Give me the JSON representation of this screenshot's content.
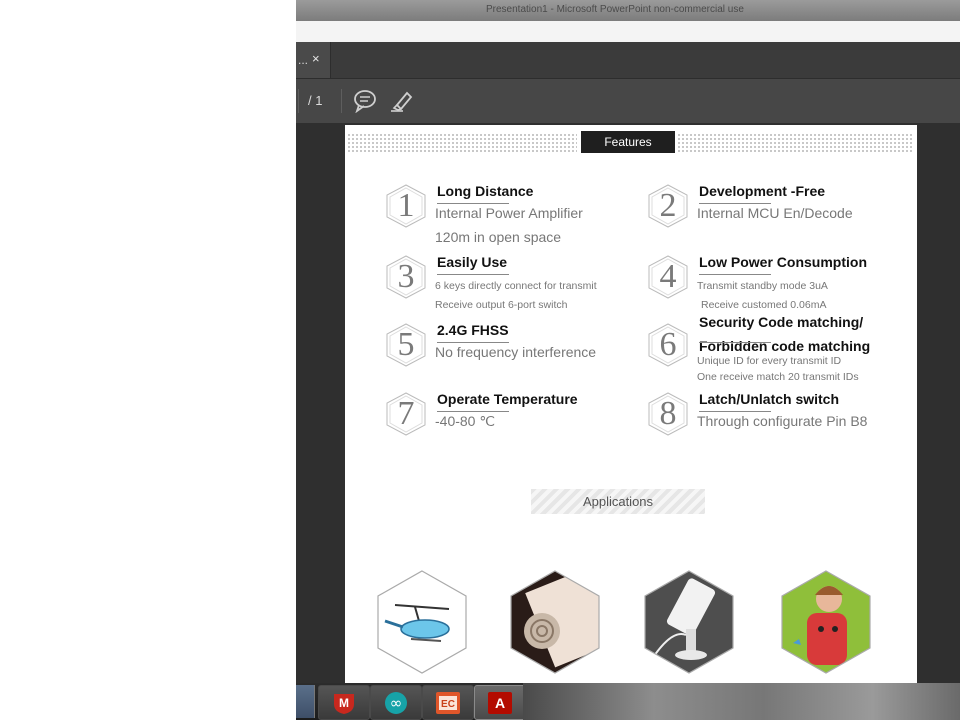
{
  "window": {
    "title": "Presentation1 - Microsoft PowerPoint non-commercial use"
  },
  "tab": {
    "label": "...",
    "close": "×"
  },
  "toolbar": {
    "page_total": "/ 1",
    "comment_icon": "comment-icon",
    "highlight_icon": "highlighter-icon"
  },
  "document": {
    "features_header": "Features",
    "features": [
      {
        "num": "1",
        "title": "Long Distance",
        "lines": [
          "Internal Power Amplifier",
          "120m in open space"
        ]
      },
      {
        "num": "2",
        "title": "Development -Free",
        "lines": [
          "Internal MCU En/Decode"
        ]
      },
      {
        "num": "3",
        "title": "Easily Use",
        "lines": [
          "6 keys directly connect for transmit",
          "Receive output 6-port switch"
        ]
      },
      {
        "num": "4",
        "title": "Low Power Consumption",
        "lines": [
          "Transmit standby mode 3uA",
          "Receive customed  0.06mA"
        ]
      },
      {
        "num": "5",
        "title": "2.4G FHSS",
        "lines": [
          "No frequency interference"
        ]
      },
      {
        "num": "6",
        "title": "Security Code matching/",
        "title2": "Forbidden code matching",
        "lines": [
          "Unique ID for every transmit ID",
          "One receive match 20 transmit IDs"
        ]
      },
      {
        "num": "7",
        "title": "Operate Temperature",
        "lines": [
          "-40-80 ℃"
        ]
      },
      {
        "num": "8",
        "title": "Latch/Unlatch switch",
        "lines": [
          "Through configurate Pin B8"
        ]
      }
    ],
    "applications_label": "Applications",
    "applications": [
      "rc-helicopter",
      "remote-keypad",
      "phone-security-stand",
      "child-backpack"
    ]
  },
  "taskbar": {
    "items": [
      {
        "name": "mcafee",
        "label": "M"
      },
      {
        "name": "arduino",
        "label": "∞"
      },
      {
        "name": "powerpoint",
        "label": "EC"
      },
      {
        "name": "acrobat",
        "label": "A"
      }
    ]
  },
  "colors": {
    "dark_bg": "#2f2f2f",
    "toolbar": "#474747",
    "accent_red": "#c8281e",
    "arduino_teal": "#17a3a8"
  }
}
